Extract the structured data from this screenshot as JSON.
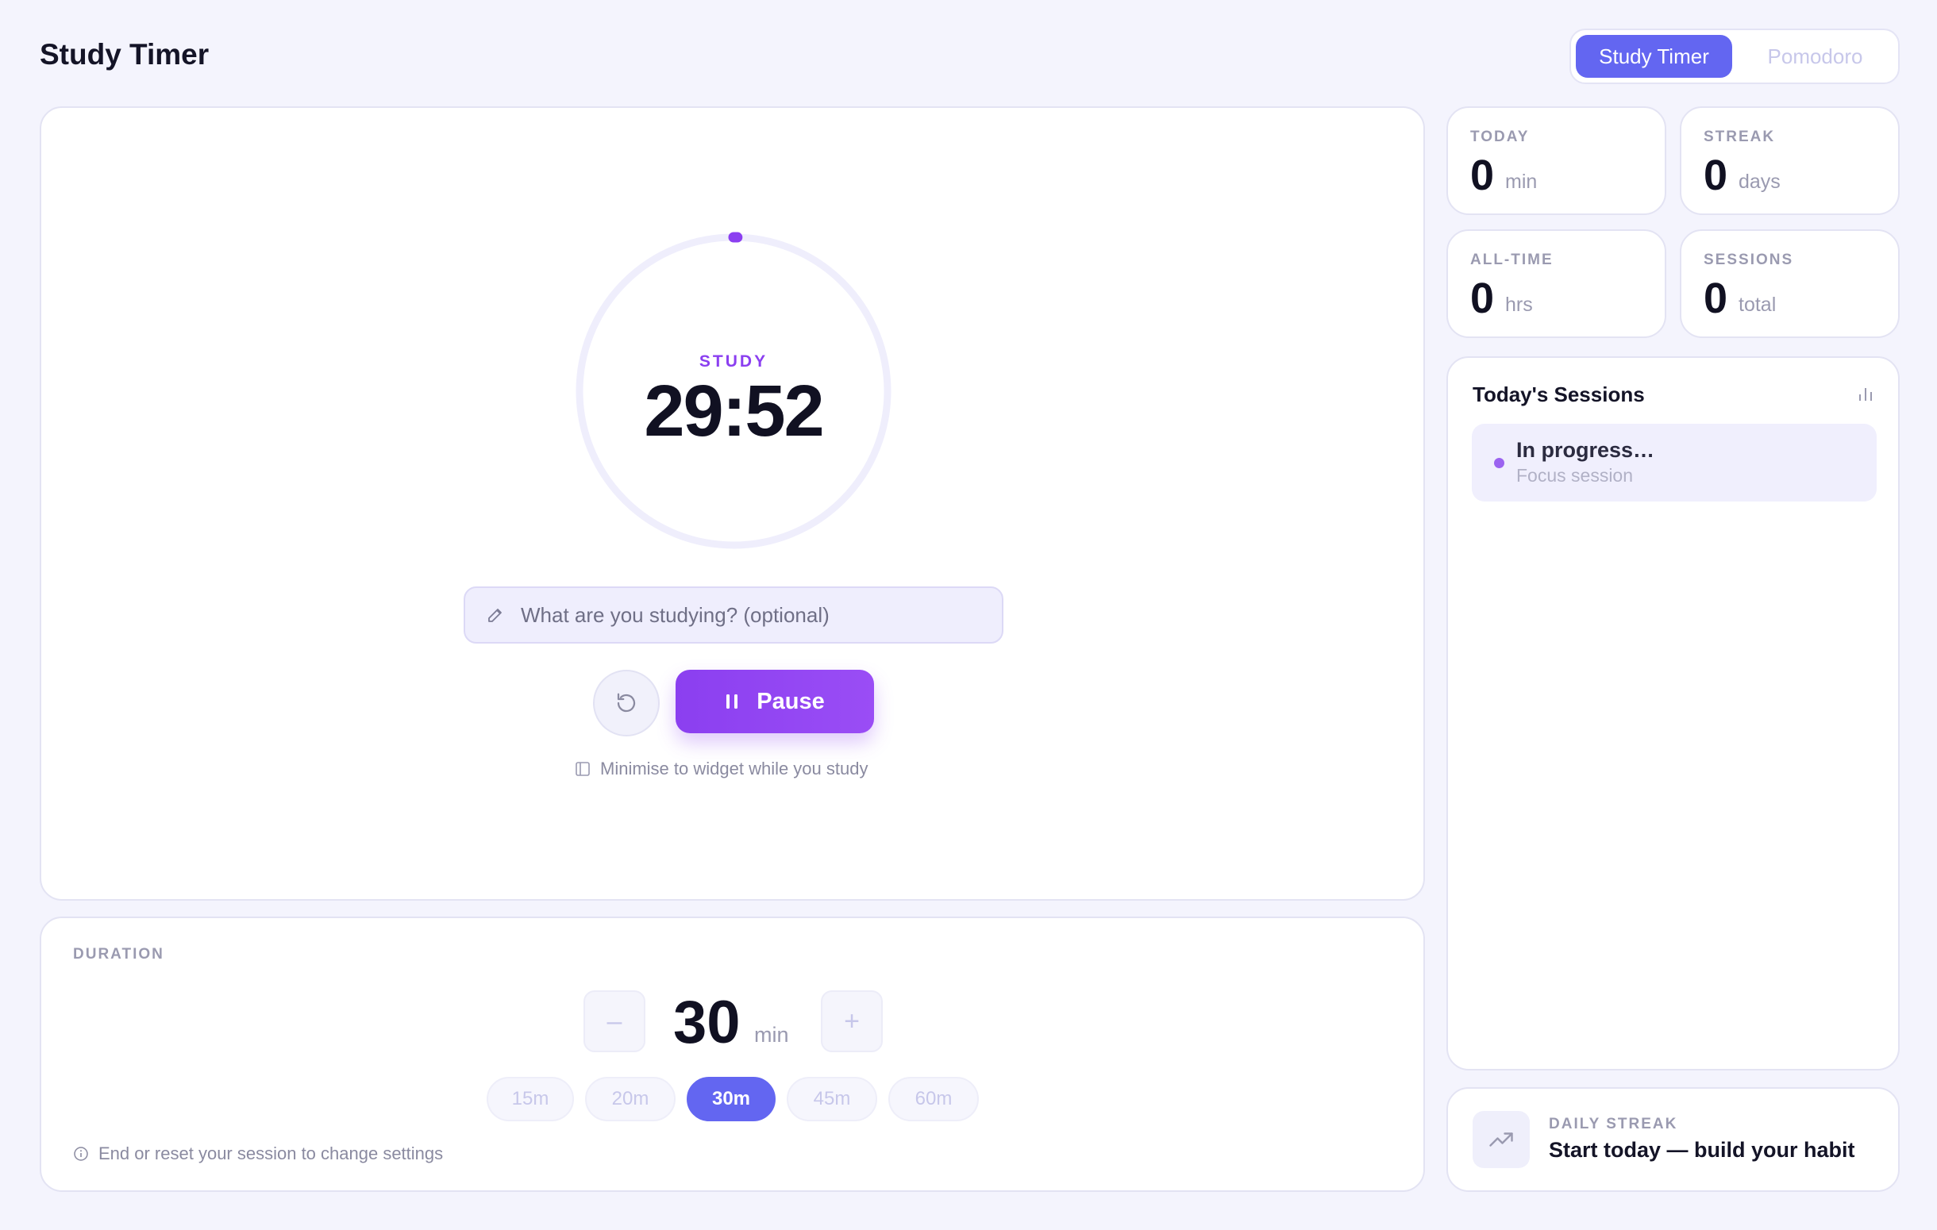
{
  "app": {
    "title": "Study Timer"
  },
  "mode_switch": {
    "tabs": [
      {
        "label": "Study Timer",
        "active": true
      },
      {
        "label": "Pomodoro",
        "active": false
      }
    ]
  },
  "timer": {
    "mode_label": "STUDY",
    "time": "29:52",
    "progress_fraction": 0.004,
    "subject_placeholder": "What are you studying? (optional)",
    "subject_value": "",
    "reset_icon": "reset-icon",
    "pause_label": "Pause",
    "pause_icon": "pause-icon",
    "minimise_label": "Minimise to widget while you study"
  },
  "duration": {
    "label": "DURATION",
    "value": "30",
    "unit": "min",
    "decrement_label": "–",
    "increment_label": "+",
    "presets": [
      {
        "label": "15m",
        "active": false
      },
      {
        "label": "20m",
        "active": false
      },
      {
        "label": "30m",
        "active": true
      },
      {
        "label": "45m",
        "active": false
      },
      {
        "label": "60m",
        "active": false
      }
    ],
    "note": "End or reset your session to change settings"
  },
  "stats": [
    {
      "label": "TODAY",
      "value": "0",
      "unit": "min"
    },
    {
      "label": "STREAK",
      "value": "0",
      "unit": "days"
    },
    {
      "label": "ALL-TIME",
      "value": "0",
      "unit": "hrs"
    },
    {
      "label": "SESSIONS",
      "value": "0",
      "unit": "total"
    }
  ],
  "sessions": {
    "title": "Today's Sessions",
    "items": [
      {
        "title": "In progress…",
        "subtitle": "Focus session"
      }
    ]
  },
  "streak": {
    "label": "DAILY STREAK",
    "text": "Start today — build your habit"
  },
  "colors": {
    "accent": "#6366f1",
    "purple": "#8b3ff0",
    "background": "#f4f4fd",
    "card": "#ffffff"
  }
}
